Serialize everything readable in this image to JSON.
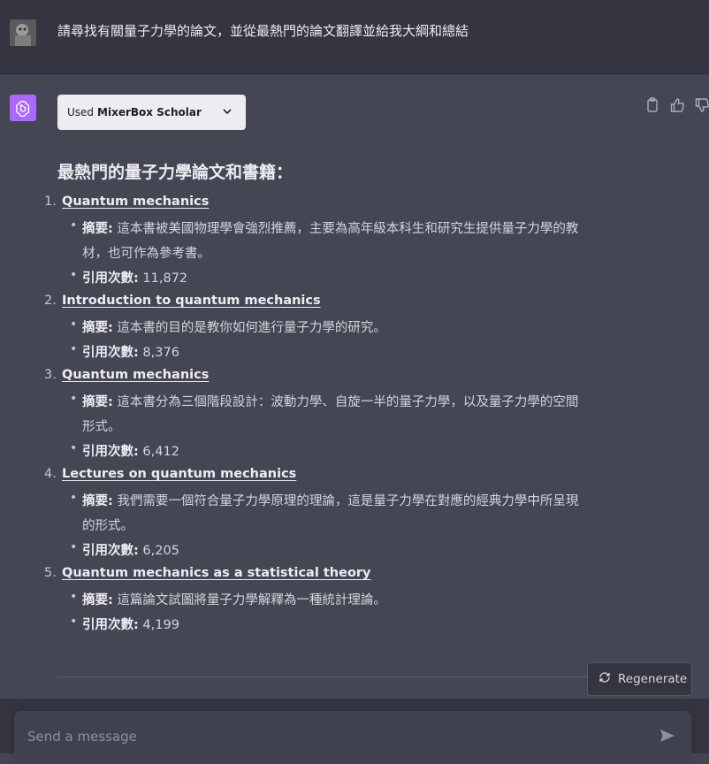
{
  "user": {
    "message": "請尋找有關量子力學的論文，並從最熱門的論文翻譯並給我大綱和總結"
  },
  "assistant": {
    "plugin": {
      "prefix": "Used",
      "name": "MixerBox Scholar"
    },
    "heading": "最熱門的量子力學論文和書籍：",
    "items": [
      {
        "num": "1.",
        "title": "Quantum mechanics",
        "summary_label": "摘要:",
        "summary_line1": "這本書被美國物理學會強烈推薦，主要為高年級本科生和研究生提供量子力學的教",
        "summary_line2": "材，也可作為參考書。",
        "citations_label": "引用次數:",
        "citations": "11,872"
      },
      {
        "num": "2.",
        "title": "Introduction to quantum mechanics",
        "summary_label": "摘要:",
        "summary_line1": "這本書的目的是教你如何進行量子力學的研究。",
        "summary_line2": "",
        "citations_label": "引用次數:",
        "citations": "8,376"
      },
      {
        "num": "3.",
        "title": "Quantum mechanics",
        "summary_label": "摘要:",
        "summary_line1": "這本書分為三個階段設計：波動力學、自旋一半的量子力學，以及量子力學的空間",
        "summary_line2": "形式。",
        "citations_label": "引用次數:",
        "citations": "6,412"
      },
      {
        "num": "4.",
        "title": "Lectures on quantum mechanics",
        "summary_label": "摘要:",
        "summary_line1": "我們需要一個符合量子力學原理的理論，這是量子力學在對應的經典力學中所呈現",
        "summary_line2": "的形式。",
        "citations_label": "引用次數:",
        "citations": "6,205"
      },
      {
        "num": "5.",
        "title": "Quantum mechanics as a statistical theory",
        "summary_label": "摘要:",
        "summary_line1": "這篇論文試圖將量子力學解釋為一種統計理論。",
        "summary_line2": "",
        "citations_label": "引用次數:",
        "citations": "4,199"
      }
    ]
  },
  "regenerate_label": "Regenerate",
  "input": {
    "placeholder": "Send a message",
    "value": ""
  },
  "colors": {
    "user_bg": "#343541",
    "assistant_bg": "#444654",
    "gpt_avatar": "#ab68ff"
  }
}
